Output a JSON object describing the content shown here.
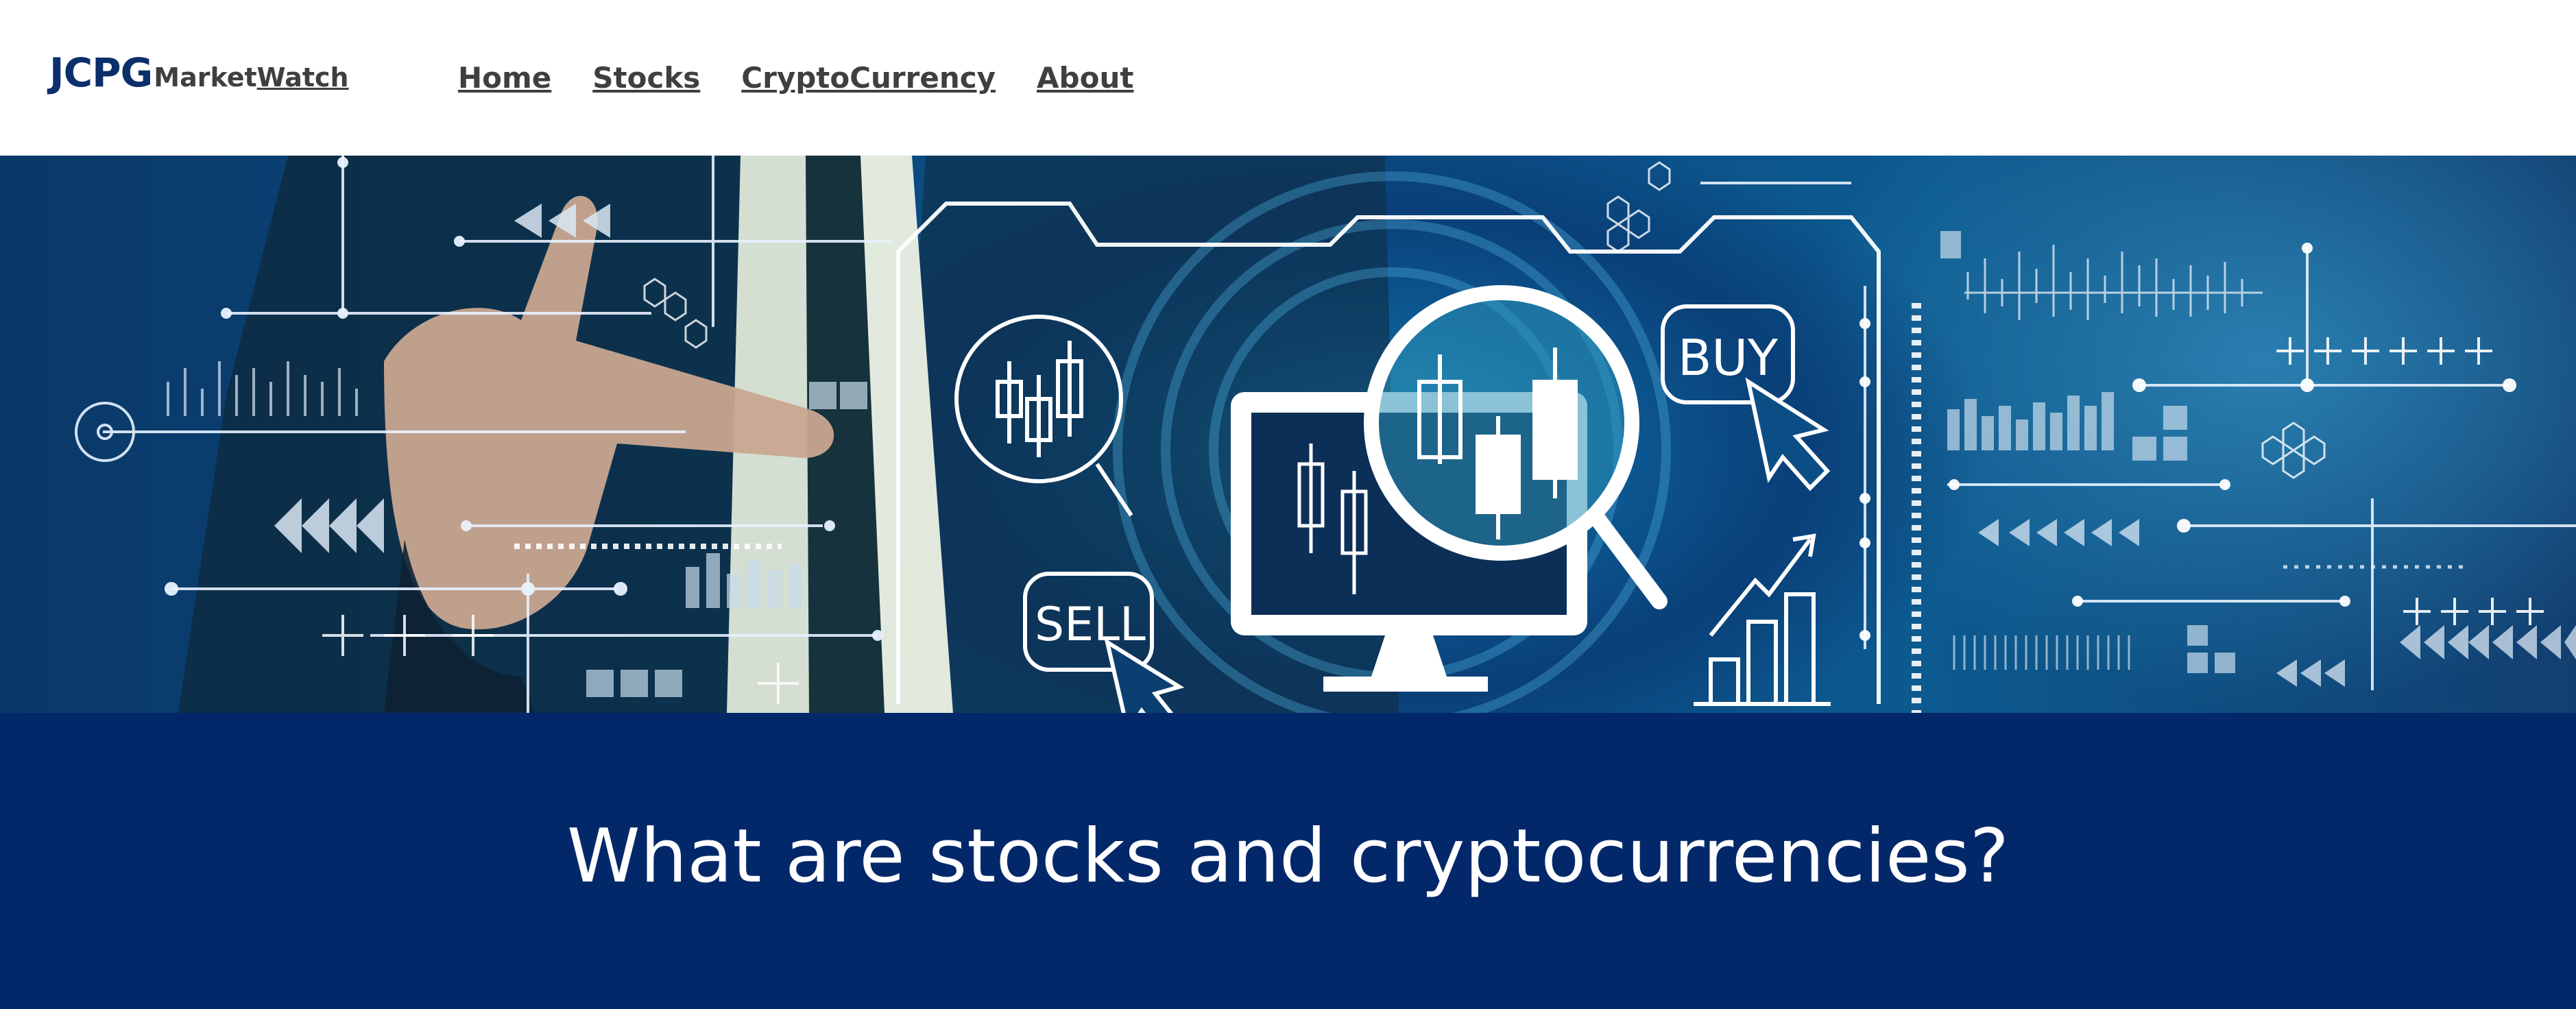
{
  "header": {
    "logo": {
      "main": "JCPG",
      "sub_part1": "Market",
      "sub_part2": "Watch"
    },
    "nav": [
      {
        "label": "Home"
      },
      {
        "label": "Stocks"
      },
      {
        "label": "CryptoCurrency"
      },
      {
        "label": "About"
      }
    ]
  },
  "banner": {
    "buy_label": "BUY",
    "sell_label": "SELL"
  },
  "intro": {
    "title": "What are stocks and cryptocurrencies?"
  },
  "colors": {
    "logo_blue": "#0b2f6b",
    "nav_text": "#3f3f3f",
    "section_blue": "#03286a",
    "banner_blue": "#0b4e86",
    "white": "#ffffff"
  }
}
